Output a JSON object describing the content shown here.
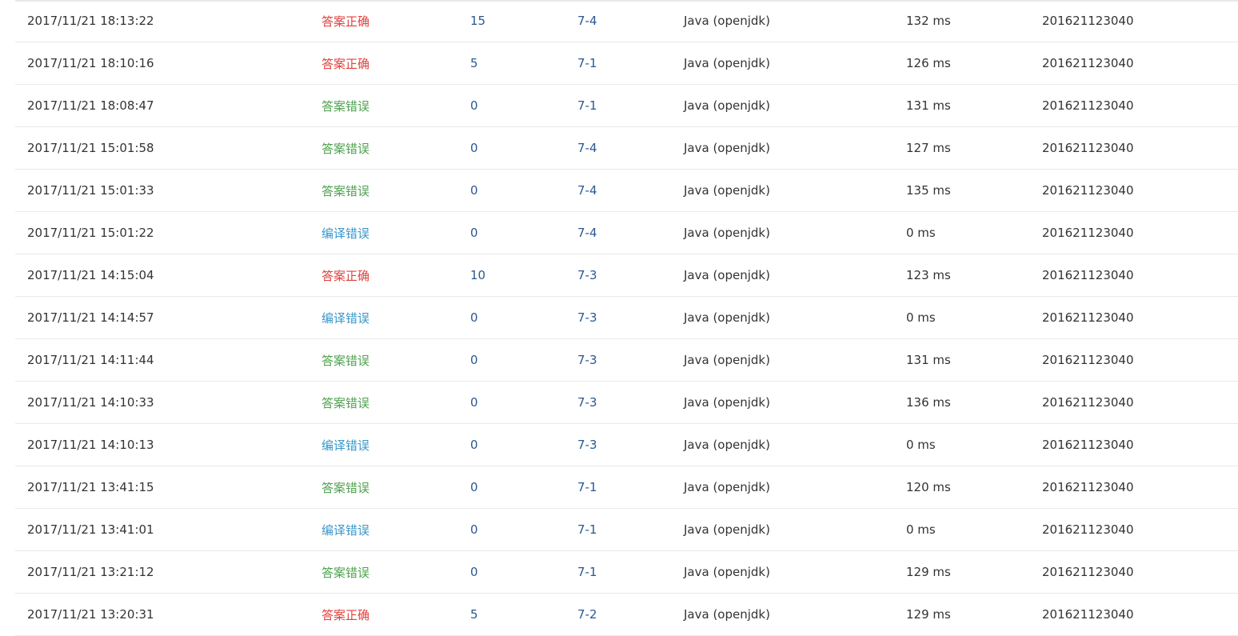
{
  "status_colors": {
    "答案正确": "#e0413e",
    "答案错误": "#4fa14f",
    "编译错误": "#3a97c9"
  },
  "submissions": [
    {
      "time": "2017/11/21 18:13:22",
      "status": "答案正确",
      "score": "15",
      "problem": "7-4",
      "language": "Java (openjdk)",
      "runtime": "132 ms",
      "user": "201621123040"
    },
    {
      "time": "2017/11/21 18:10:16",
      "status": "答案正确",
      "score": "5",
      "problem": "7-1",
      "language": "Java (openjdk)",
      "runtime": "126 ms",
      "user": "201621123040"
    },
    {
      "time": "2017/11/21 18:08:47",
      "status": "答案错误",
      "score": "0",
      "problem": "7-1",
      "language": "Java (openjdk)",
      "runtime": "131 ms",
      "user": "201621123040"
    },
    {
      "time": "2017/11/21 15:01:58",
      "status": "答案错误",
      "score": "0",
      "problem": "7-4",
      "language": "Java (openjdk)",
      "runtime": "127 ms",
      "user": "201621123040"
    },
    {
      "time": "2017/11/21 15:01:33",
      "status": "答案错误",
      "score": "0",
      "problem": "7-4",
      "language": "Java (openjdk)",
      "runtime": "135 ms",
      "user": "201621123040"
    },
    {
      "time": "2017/11/21 15:01:22",
      "status": "编译错误",
      "score": "0",
      "problem": "7-4",
      "language": "Java (openjdk)",
      "runtime": "0 ms",
      "user": "201621123040"
    },
    {
      "time": "2017/11/21 14:15:04",
      "status": "答案正确",
      "score": "10",
      "problem": "7-3",
      "language": "Java (openjdk)",
      "runtime": "123 ms",
      "user": "201621123040"
    },
    {
      "time": "2017/11/21 14:14:57",
      "status": "编译错误",
      "score": "0",
      "problem": "7-3",
      "language": "Java (openjdk)",
      "runtime": "0 ms",
      "user": "201621123040"
    },
    {
      "time": "2017/11/21 14:11:44",
      "status": "答案错误",
      "score": "0",
      "problem": "7-3",
      "language": "Java (openjdk)",
      "runtime": "131 ms",
      "user": "201621123040"
    },
    {
      "time": "2017/11/21 14:10:33",
      "status": "答案错误",
      "score": "0",
      "problem": "7-3",
      "language": "Java (openjdk)",
      "runtime": "136 ms",
      "user": "201621123040"
    },
    {
      "time": "2017/11/21 14:10:13",
      "status": "编译错误",
      "score": "0",
      "problem": "7-3",
      "language": "Java (openjdk)",
      "runtime": "0 ms",
      "user": "201621123040"
    },
    {
      "time": "2017/11/21 13:41:15",
      "status": "答案错误",
      "score": "0",
      "problem": "7-1",
      "language": "Java (openjdk)",
      "runtime": "120 ms",
      "user": "201621123040"
    },
    {
      "time": "2017/11/21 13:41:01",
      "status": "编译错误",
      "score": "0",
      "problem": "7-1",
      "language": "Java (openjdk)",
      "runtime": "0 ms",
      "user": "201621123040"
    },
    {
      "time": "2017/11/21 13:21:12",
      "status": "答案错误",
      "score": "0",
      "problem": "7-1",
      "language": "Java (openjdk)",
      "runtime": "129 ms",
      "user": "201621123040"
    },
    {
      "time": "2017/11/21 13:20:31",
      "status": "答案正确",
      "score": "5",
      "problem": "7-2",
      "language": "Java (openjdk)",
      "runtime": "129 ms",
      "user": "201621123040"
    }
  ]
}
